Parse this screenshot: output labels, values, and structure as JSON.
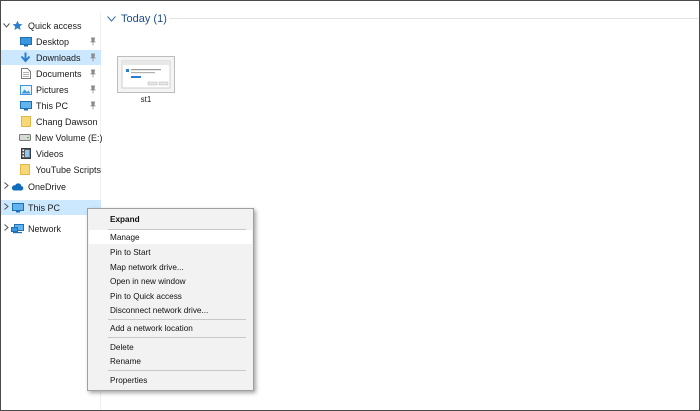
{
  "nav": {
    "quick_access": "Quick access",
    "quick_items": [
      {
        "label": "Desktop",
        "icon": "desktop-icon",
        "pinned": true
      },
      {
        "label": "Downloads",
        "icon": "downloads-icon",
        "pinned": true
      },
      {
        "label": "Documents",
        "icon": "documents-icon",
        "pinned": true
      },
      {
        "label": "Pictures",
        "icon": "pictures-icon",
        "pinned": true
      },
      {
        "label": "This PC",
        "icon": "this-pc-icon",
        "pinned": true
      },
      {
        "label": "Chang Dawson",
        "icon": "folder-icon",
        "pinned": false
      },
      {
        "label": "New Volume (E:)",
        "icon": "drive-icon",
        "pinned": false
      },
      {
        "label": "Videos",
        "icon": "videos-icon",
        "pinned": false
      },
      {
        "label": "YouTube Scripts",
        "icon": "folder-icon",
        "pinned": false
      }
    ],
    "onedrive": "OneDrive",
    "this_pc": "This PC",
    "network": "Network"
  },
  "content": {
    "group_header": "Today (1)",
    "file": {
      "name": "st1"
    }
  },
  "context_menu": {
    "expand": "Expand",
    "manage": "Manage",
    "pin_to_start": "Pin to Start",
    "map_network_drive": "Map network drive...",
    "open_in_new_window": "Open in new window",
    "pin_to_quick_access": "Pin to Quick access",
    "disconnect_network_drive": "Disconnect network drive...",
    "add_network_location": "Add a network location",
    "delete": "Delete",
    "rename": "Rename",
    "properties": "Properties"
  },
  "colors": {
    "selection": "#cce8ff",
    "hover": "#e5f3ff",
    "group_header": "#1e4e8c",
    "menu_bg": "#f2f2f2",
    "folder": "#f8d775"
  }
}
